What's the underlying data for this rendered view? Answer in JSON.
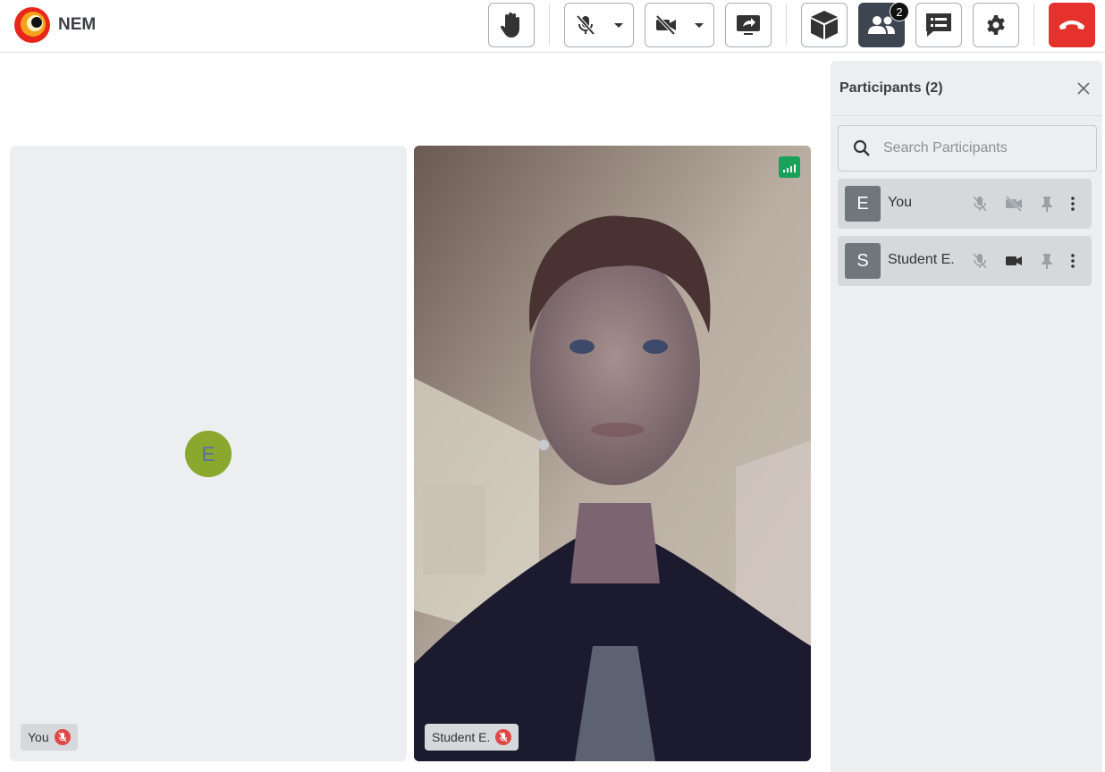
{
  "app": {
    "name": "NEM"
  },
  "toolbar": {
    "participants_count": "2"
  },
  "video_tiles": [
    {
      "name": "You",
      "avatar_letter": "E"
    },
    {
      "name": "Student E."
    }
  ],
  "participants_panel": {
    "title": "Participants (2)",
    "search_placeholder": "Search Participants",
    "items": [
      {
        "letter": "E",
        "name": "You",
        "mic": "muted",
        "camera": "off"
      },
      {
        "letter": "S",
        "name": "Student E.",
        "mic": "muted",
        "camera": "on"
      }
    ]
  },
  "colors": {
    "hangup": "#e5322d",
    "active_button": "#3d4650",
    "avatar_green": "#8aa82e",
    "signal_green": "#1aa15a",
    "mute_red": "#e04848"
  }
}
